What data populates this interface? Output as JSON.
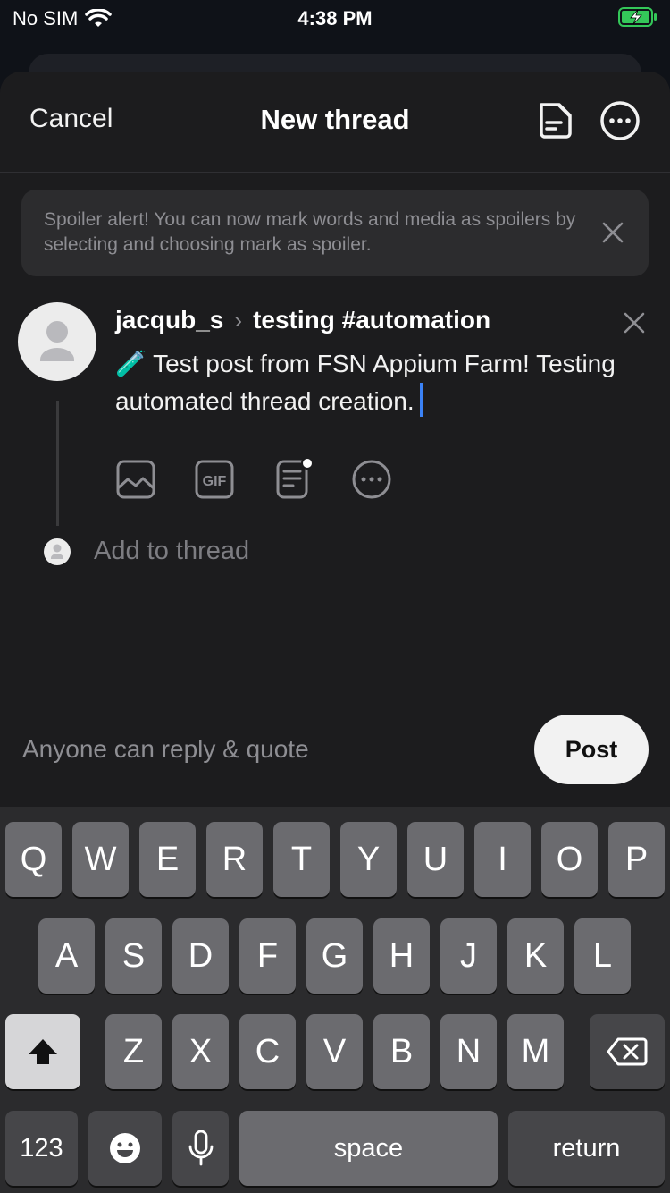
{
  "status_bar": {
    "carrier": "No SIM",
    "time": "4:38 PM"
  },
  "nav": {
    "cancel_label": "Cancel",
    "title": "New thread",
    "icons": [
      "drafts-icon",
      "more-options-icon"
    ]
  },
  "banner": {
    "text": "Spoiler alert! You can now mark words and media as spoilers by selecting and choosing mark as spoiler."
  },
  "compose": {
    "username": "jacqub_s",
    "topic": "testing #automation",
    "emoji": "🧪",
    "text": "Test post from FSN Appium Farm! Testing automated thread creation.",
    "toolbar_icons": [
      "image-icon",
      "gif-icon",
      "poll-icon",
      "more-icon"
    ],
    "add_to_thread_placeholder": "Add to thread"
  },
  "footer": {
    "reply_setting": "Anyone can reply & quote",
    "post_label": "Post"
  },
  "keyboard": {
    "row1": [
      "Q",
      "W",
      "E",
      "R",
      "T",
      "Y",
      "U",
      "I",
      "O",
      "P"
    ],
    "row2": [
      "A",
      "S",
      "D",
      "F",
      "G",
      "H",
      "J",
      "K",
      "L"
    ],
    "row3": [
      "Z",
      "X",
      "C",
      "V",
      "B",
      "N",
      "M"
    ],
    "numbers_label": "123",
    "space_label": "space",
    "return_label": "return"
  }
}
